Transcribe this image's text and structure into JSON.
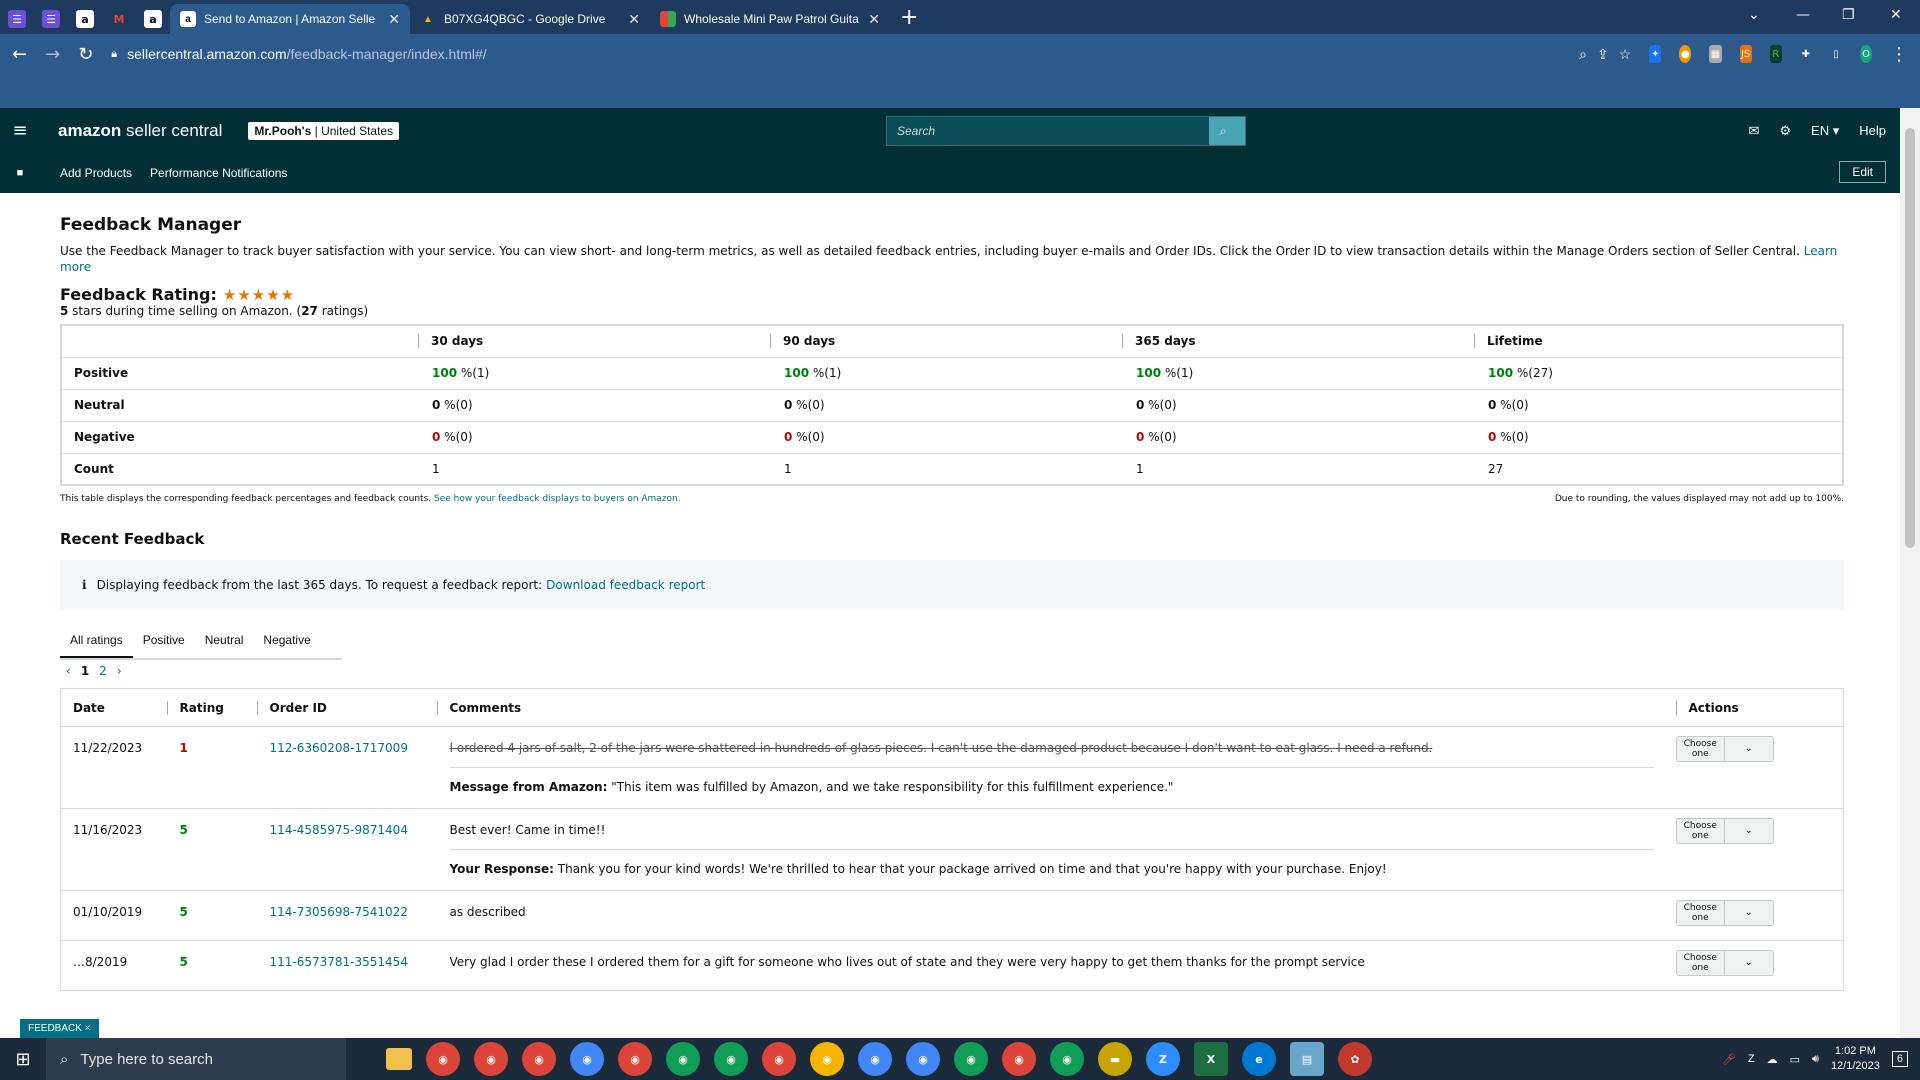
{
  "browser": {
    "tabs": [
      {
        "title": "Send to Amazon | Amazon Selle",
        "active": true
      },
      {
        "title": "B07XG4QBGC - Google Drive",
        "active": false
      },
      {
        "title": "Wholesale Mini Paw Patrol Guita",
        "active": false
      }
    ],
    "url_domain": "sellercentral.amazon.com",
    "url_path": "/feedback-manager/index.html#/",
    "profile_initial": "O"
  },
  "header": {
    "logo_main": "amazon",
    "logo_sub": "seller central",
    "store_name": "Mr.Pooh's",
    "store_region": "United States",
    "search_placeholder": "Search",
    "lang": "EN",
    "help": "Help"
  },
  "subnav": {
    "items": [
      "Add Products",
      "Performance Notifications"
    ],
    "edit": "Edit"
  },
  "page": {
    "title": "Feedback Manager",
    "description": "Use the Feedback Manager to track buyer satisfaction with your service. You can view short- and long-term metrics, as well as detailed feedback entries, including buyer e-mails and Order IDs. Click the Order ID to view transaction details within the Manage Orders section of Seller Central.",
    "learn_more": "Learn more",
    "rating_label": "Feedback Rating:",
    "rating_stars": 5,
    "rating_sub_stars": "5",
    "rating_sub_text": " stars during time selling on Amazon. (",
    "rating_count": "27",
    "rating_sub_end": " ratings)"
  },
  "metrics": {
    "columns": [
      "30 days",
      "90 days",
      "365 days",
      "Lifetime"
    ],
    "rows": [
      {
        "label": "Positive",
        "cells": [
          {
            "pct": "100",
            "cnt": " %(1)"
          },
          {
            "pct": "100",
            "cnt": " %(1)"
          },
          {
            "pct": "100",
            "cnt": " %(1)"
          },
          {
            "pct": "100",
            "cnt": " %(27)"
          }
        ]
      },
      {
        "label": "Neutral",
        "cells": [
          {
            "pct": "0",
            "cnt": " %(0)"
          },
          {
            "pct": "0",
            "cnt": " %(0)"
          },
          {
            "pct": "0",
            "cnt": " %(0)"
          },
          {
            "pct": "0",
            "cnt": " %(0)"
          }
        ]
      },
      {
        "label": "Negative",
        "cells": [
          {
            "pct": "0",
            "cnt": " %(0)"
          },
          {
            "pct": "0",
            "cnt": " %(0)"
          },
          {
            "pct": "0",
            "cnt": " %(0)"
          },
          {
            "pct": "0",
            "cnt": " %(0)"
          }
        ]
      },
      {
        "label": "Count",
        "cells": [
          {
            "pct": "",
            "cnt": "1"
          },
          {
            "pct": "",
            "cnt": "1"
          },
          {
            "pct": "",
            "cnt": "1"
          },
          {
            "pct": "",
            "cnt": "27"
          }
        ]
      }
    ],
    "note_left": "This table displays the corresponding feedback percentages and feedback counts.",
    "note_link": "See how your feedback displays to buyers on Amazon.",
    "note_right": "Due to rounding, the values displayed may not add up to 100%."
  },
  "recent": {
    "title": "Recent Feedback",
    "info_text": "Displaying feedback from the last 365 days. To request a feedback report:",
    "info_link": "Download feedback report",
    "filter_tabs": [
      "All ratings",
      "Positive",
      "Neutral",
      "Negative"
    ],
    "pages": [
      "1",
      "2"
    ],
    "columns": [
      "Date",
      "Rating",
      "Order ID",
      "Comments",
      "Actions"
    ],
    "action_label": "Choose one",
    "rows": [
      {
        "date": "11/22/2023",
        "rating": "1",
        "order_id": "112-6360208-1717009",
        "comment": "I ordered 4 jars of salt, 2 of the jars were shattered in hundreds of glass pieces. I can't use the damaged product because I don't want to eat glass. I need a refund.",
        "struck": true,
        "resp_label": "Message from Amazon:",
        "resp_text": " \"This item was fulfilled by Amazon, and we take responsibility for this fulfillment experience.\""
      },
      {
        "date": "11/16/2023",
        "rating": "5",
        "order_id": "114-4585975-9871404",
        "comment": "Best ever! Came in time!!",
        "struck": false,
        "resp_label": "Your Response:",
        "resp_text": " Thank you for your kind words! We're thrilled to hear that your package arrived on time and that you're happy with your purchase. Enjoy!"
      },
      {
        "date": "01/10/2019",
        "rating": "5",
        "order_id": "114-7305698-7541022",
        "comment": "as described",
        "struck": false,
        "resp_label": "",
        "resp_text": ""
      },
      {
        "date": "…8/2019",
        "rating": "5",
        "order_id": "111-6573781-3551454",
        "comment": "Very glad I order these I ordered them for a gift for someone who lives out of state and they were very happy to get them thanks for the prompt service",
        "struck": false,
        "resp_label": "",
        "resp_text": ""
      }
    ]
  },
  "feedback_pill": "FEEDBACK ×",
  "taskbar": {
    "search_placeholder": "Type here to search",
    "time": "1:02 PM",
    "date": "12/1/2023",
    "notif_count": "6"
  },
  "colors": {
    "positive": "#00800b",
    "negative": "#c40000",
    "link": "#007185",
    "header_bg": "#002f36"
  }
}
